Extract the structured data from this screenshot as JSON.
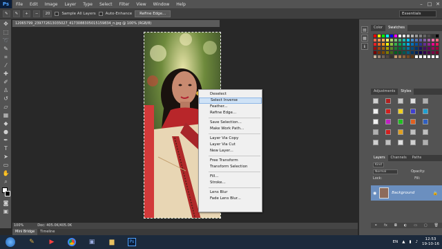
{
  "app": {
    "logo": "Ps"
  },
  "menu": [
    "File",
    "Edit",
    "Image",
    "Layer",
    "Type",
    "Select",
    "Filter",
    "View",
    "Window",
    "Help"
  ],
  "options": {
    "brush_size": "20",
    "sample_all_layers": "Sample All Layers",
    "auto_enhance": "Auto-Enhance",
    "refine_edge": "Refine Edge...",
    "workspace": "Essentials"
  },
  "document": {
    "tab_title": "12065799_239772613035027_4173088305015159834_n.jpg @ 100% (RGB/8)",
    "zoom": "100%",
    "doc_size": "Doc: 405.0K/405.0K"
  },
  "context_menu": [
    {
      "label": "Deselect"
    },
    {
      "label": "Select Inverse",
      "highlight": true
    },
    {
      "label": "Feather..."
    },
    {
      "label": "Refine Edge..."
    },
    {
      "sep": true
    },
    {
      "label": "Save Selection..."
    },
    {
      "label": "Make Work Path..."
    },
    {
      "sep": true
    },
    {
      "label": "Layer Via Copy"
    },
    {
      "label": "Layer Via Cut"
    },
    {
      "label": "New Layer..."
    },
    {
      "sep": true
    },
    {
      "label": "Free Transform"
    },
    {
      "label": "Transform Selection"
    },
    {
      "sep": true
    },
    {
      "label": "Fill..."
    },
    {
      "label": "Stroke..."
    },
    {
      "sep": true
    },
    {
      "label": "Lens Blur"
    },
    {
      "label": "Fade Lens Blur..."
    }
  ],
  "bottom_tabs": [
    "Mini Bridge",
    "Timeline"
  ],
  "panels": {
    "color_tab": "Color",
    "swatches_tab": "Swatches",
    "adjustments_tab": "Adjustments",
    "styles_tab": "Styles",
    "layers_tab": "Layers",
    "channels_tab": "Channels",
    "paths_tab": "Paths",
    "kind": "Kind",
    "blend_mode": "Normal",
    "opacity_label": "Opacity:",
    "lock_label": "Lock:",
    "fill_label": "Fill:",
    "layer_name": "Background"
  },
  "taskbar": {
    "lang": "EN",
    "time": "12:53",
    "date": "19-10-16"
  },
  "colors": {
    "selection_highlight": "#cfe2f6",
    "layer_selected": "#6b8fbf"
  }
}
